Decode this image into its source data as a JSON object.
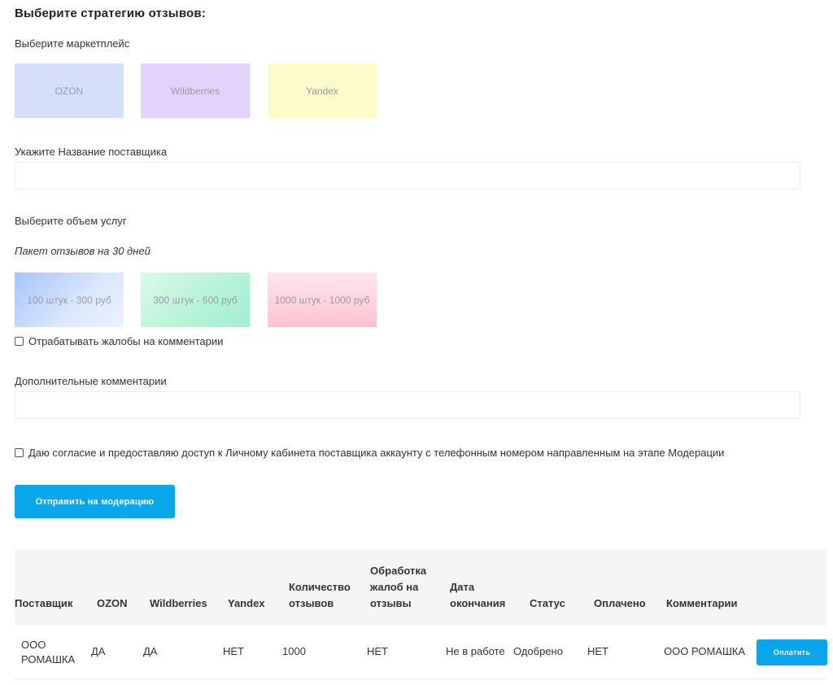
{
  "form": {
    "title": "Выберите стратегию отзывов:",
    "marketplace_label": "Выберите маркетплейс",
    "marketplaces": [
      "OZON",
      "Wildberries",
      "Yandex"
    ],
    "supplier_label": "Укажите Название поставщика",
    "supplier_value": "",
    "volume_label": "Выберите объем услуг",
    "package_label": "Пакет отзывов на 30 дней",
    "packages": [
      "100 штук - 300 руб",
      "300 штук - 600 руб",
      "1000 штук - 1000 руб"
    ],
    "complaints_checkbox": "Отрабатывать жалобы на комментарии",
    "comments_label": "Дополнительные комментарии",
    "comments_value": "",
    "consent_checkbox": "Даю согласие и предоставляю доступ к Личному кабинета поставщика аккаунту с телефонным номером направленным на этапе Модерации",
    "submit_label": "Отправить на модерацию"
  },
  "table": {
    "headers": [
      "Поставщик",
      "OZON",
      "Wildberries",
      "Yandex",
      "Количество\nотзывов",
      "Обработка\nжалоб на\nотзывы",
      "Дата\nокончания",
      "Статус",
      "Оплачено",
      "Комментарии"
    ],
    "rows": [
      {
        "supplier": "ООО\nРОМАШКА",
        "ozon": "ДА",
        "wildberries": "ДА",
        "yandex": "НЕТ",
        "count": "1000",
        "complaints": "НЕТ",
        "end_date": "Не в работе",
        "status": "Одобрено",
        "paid": "НЕТ",
        "comments": "ООО РОМАШКА",
        "pay_label": "Оплатить"
      }
    ]
  },
  "colors": {
    "accent": "#0aa6ea",
    "tile_ozon": "#d5dffc",
    "tile_wildberries": "#e3d2fb",
    "tile_yandex": "#fdfbc9"
  }
}
